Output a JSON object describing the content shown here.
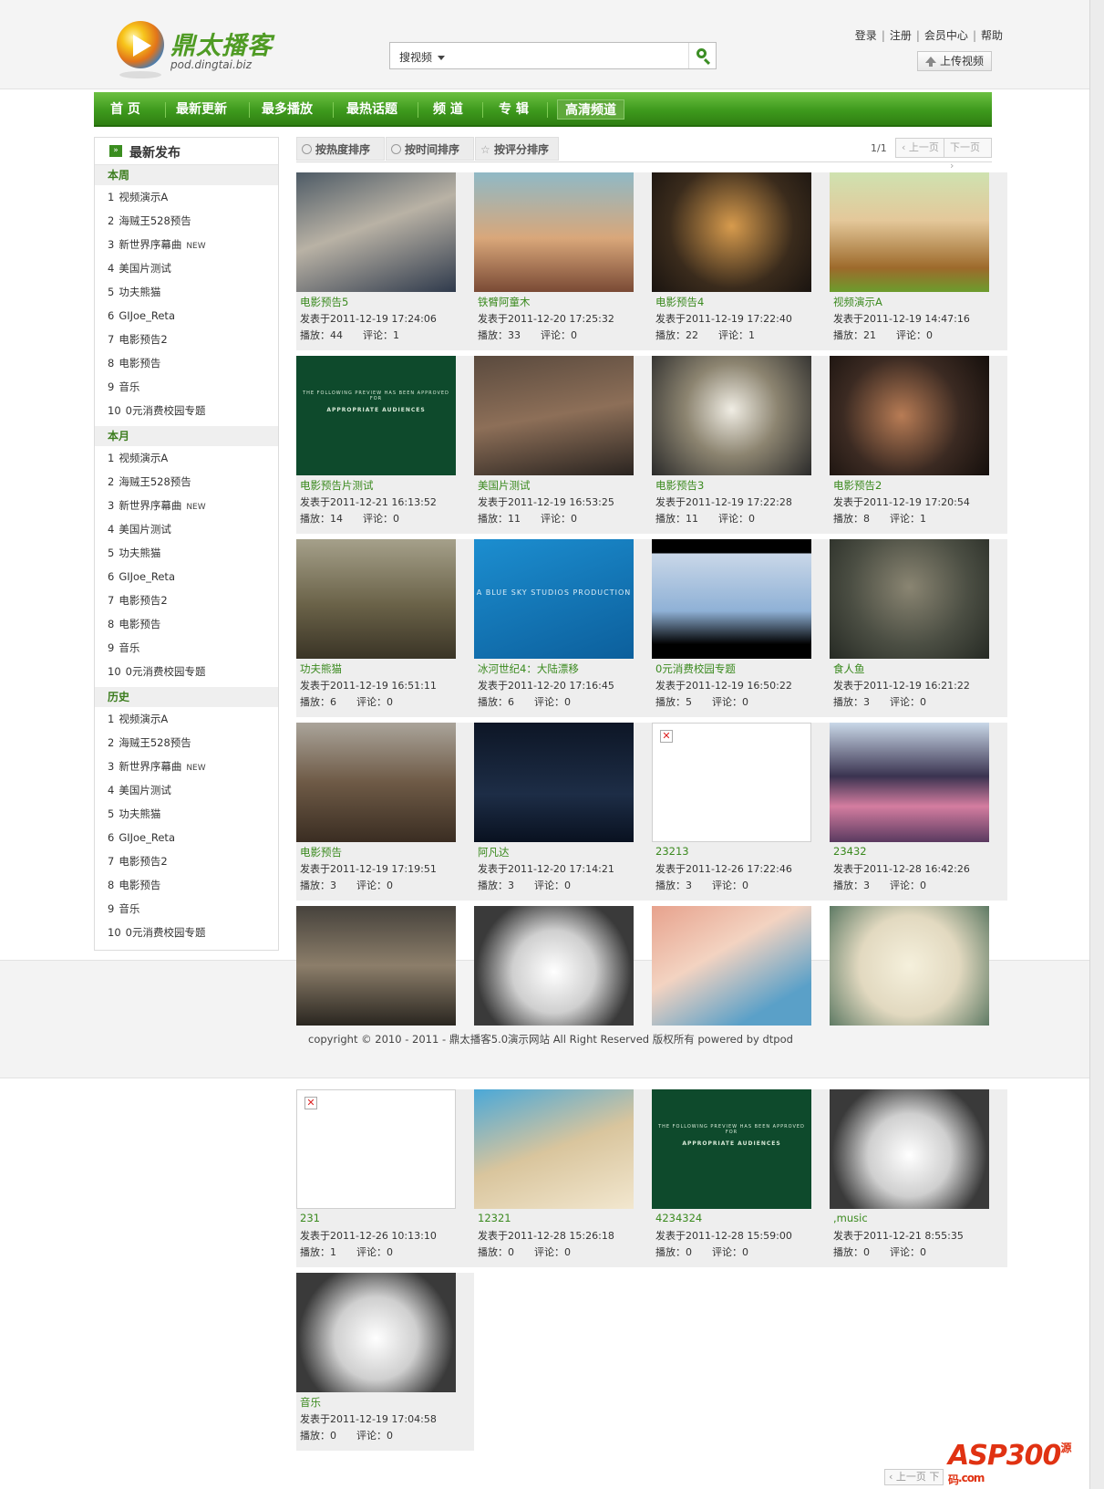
{
  "header": {
    "logo_name": "鼎太播客",
    "logo_url": "pod.dingtai.biz",
    "search_select": "搜视频",
    "links": [
      "登录",
      "注册",
      "会员中心",
      "帮助"
    ],
    "upload_label": "上传视频"
  },
  "nav": [
    "首 页",
    "最新更新",
    "最多播放",
    "最热话题",
    "频 道",
    "专 辑",
    "高清频道"
  ],
  "sidebar": {
    "title": "最新发布",
    "sections": [
      {
        "label": "本周",
        "items": [
          "视频演示A",
          "海贼王528预告",
          "新世界序幕曲",
          "美国片测试",
          "功夫熊猫",
          "GIJoe_Reta",
          "电影预告2",
          "电影预告",
          "音乐",
          "0元消费校园专题"
        ]
      },
      {
        "label": "本月",
        "items": [
          "视频演示A",
          "海贼王528预告",
          "新世界序幕曲",
          "美国片测试",
          "功夫熊猫",
          "GIJoe_Reta",
          "电影预告2",
          "电影预告",
          "音乐",
          "0元消费校园专题"
        ]
      },
      {
        "label": "历史",
        "items": [
          "视频演示A",
          "海贼王528预告",
          "新世界序幕曲",
          "美国片测试",
          "功夫熊猫",
          "GIJoe_Reta",
          "电影预告2",
          "电影预告",
          "音乐",
          "0元消费校园专题"
        ]
      }
    ],
    "new_tag": "NEW"
  },
  "sortbar": {
    "buttons": [
      "按热度排序",
      "按时间排序",
      "按评分排序"
    ],
    "page_info": "1/1",
    "prev": "上一页",
    "next": "下一页"
  },
  "labels": {
    "posted": "发表于",
    "plays": "播放：",
    "comments": "评论："
  },
  "videos": [
    {
      "title": "电影预告5",
      "date": "2011-12-19 17:24:06",
      "plays": "44",
      "comments": "1"
    },
    {
      "title": "铁臂阿童木",
      "date": "2011-12-20 17:25:32",
      "plays": "33",
      "comments": "0"
    },
    {
      "title": "电影预告4",
      "date": "2011-12-19 17:22:40",
      "plays": "22",
      "comments": "1"
    },
    {
      "title": "视频演示A",
      "date": "2011-12-19 14:47:16",
      "plays": "21",
      "comments": "0"
    },
    {
      "title": "电影预告片测试",
      "date": "2011-12-21 16:13:52",
      "plays": "14",
      "comments": "0"
    },
    {
      "title": "美国片测试",
      "date": "2011-12-19 16:53:25",
      "plays": "11",
      "comments": "0"
    },
    {
      "title": "电影预告3",
      "date": "2011-12-19 17:22:28",
      "plays": "11",
      "comments": "0"
    },
    {
      "title": "电影预告2",
      "date": "2011-12-19 17:20:54",
      "plays": "8",
      "comments": "1"
    },
    {
      "title": "功夫熊猫",
      "date": "2011-12-19 16:51:11",
      "plays": "6",
      "comments": "0"
    },
    {
      "title": "冰河世纪4：大陆漂移",
      "date": "2011-12-20 17:16:45",
      "plays": "6",
      "comments": "0"
    },
    {
      "title": "0元消费校园专题",
      "date": "2011-12-19 16:50:22",
      "plays": "5",
      "comments": "0"
    },
    {
      "title": "食人鱼",
      "date": "2011-12-19 16:21:22",
      "plays": "3",
      "comments": "0"
    },
    {
      "title": "电影预告",
      "date": "2011-12-19 17:19:51",
      "plays": "3",
      "comments": "0"
    },
    {
      "title": "阿凡达",
      "date": "2011-12-20 17:14:21",
      "plays": "3",
      "comments": "0"
    },
    {
      "title": "23213",
      "date": "2011-12-26 17:22:46",
      "plays": "3",
      "comments": "0"
    },
    {
      "title": "23432",
      "date": "2011-12-28 16:42:26",
      "plays": "3",
      "comments": "0"
    },
    {
      "title": "",
      "date": "",
      "plays": "",
      "comments": ""
    },
    {
      "title": "",
      "date": "",
      "plays": "",
      "comments": ""
    },
    {
      "title": "",
      "date": "",
      "plays": "",
      "comments": ""
    },
    {
      "title": "",
      "date": "",
      "plays": "",
      "comments": ""
    },
    {
      "title": "231",
      "date": "2011-12-26 10:13:10",
      "plays": "1",
      "comments": "0"
    },
    {
      "title": "12321",
      "date": "2011-12-28 15:26:18",
      "plays": "0",
      "comments": "0"
    },
    {
      "title": "4234324",
      "date": "2011-12-28 15:59:00",
      "plays": "0",
      "comments": "0"
    },
    {
      "title": ",music",
      "date": "2011-12-21 8:55:35",
      "plays": "0",
      "comments": "0"
    },
    {
      "title": "音乐",
      "date": "2011-12-19 17:04:58",
      "plays": "0",
      "comments": "0"
    }
  ],
  "thumb_texts": {
    "mpaa_line1": "THE FOLLOWING PREVIEW HAS BEEN APPROVED FOR",
    "mpaa_line2": "APPROPRIATE AUDIENCES",
    "blue_sky": "A BLUE SKY STUDIOS PRODUCTION"
  },
  "footer": {
    "copyright": "copyright © 2010 - 2011 - 鼎太播客5.0演示网站  All Right Reserved 版权所有  powered by dtpod"
  },
  "bottom_pager": "上一页  下",
  "watermark": {
    "brand": "ASP300",
    "sub": "源码",
    "suffix": ".com"
  },
  "colors": {
    "brand_green": "#3e9a1d",
    "link_green": "#3b8a1f",
    "watermark_red": "#e03212"
  }
}
